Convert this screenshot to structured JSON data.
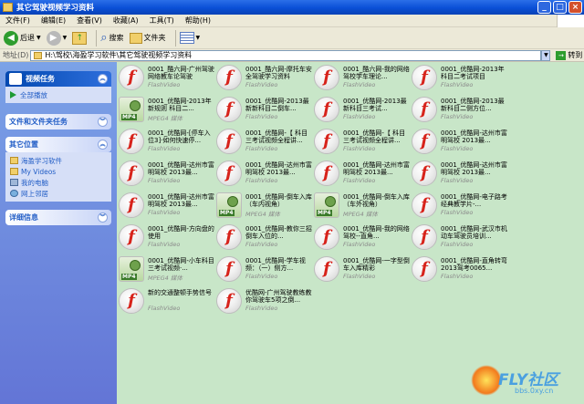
{
  "window": {
    "title": "其它驾驶视频学习资料"
  },
  "menu": [
    "文件(F)",
    "编辑(E)",
    "查看(V)",
    "收藏(A)",
    "工具(T)",
    "帮助(H)"
  ],
  "toolbar": {
    "back": "后退",
    "search": "搜索",
    "folders": "文件夹"
  },
  "address": {
    "label": "地址(D)",
    "path": "H:\\驾校\\海盈学习软件\\其它驾驶视频学习资料",
    "go": "转到"
  },
  "left": {
    "video_tasks": {
      "title": "视频任务",
      "play_all": "全部播放"
    },
    "file_tasks": {
      "title": "文件和文件夹任务"
    },
    "other_places": {
      "title": "其它位置",
      "items": [
        "海盈学习软件",
        "My Videos",
        "我的电脑",
        "网上邻居"
      ]
    },
    "details": {
      "title": "详细信息"
    }
  },
  "files": [
    {
      "name": "0001_酷六网-广州驾驶网络教车论驾驶",
      "type": "FlashVideo",
      "icon": "flash"
    },
    {
      "name": "0001_酷六网-摩托车安全驾驶学习资料",
      "type": "FlashVideo",
      "icon": "flash"
    },
    {
      "name": "0001_酷六网-我的网络驾校学车理论...",
      "type": "FlashVideo",
      "icon": "flash"
    },
    {
      "name": "0001_优酷网-2013年科目二考试项目",
      "type": "FlashVideo",
      "icon": "flash"
    },
    {
      "name": "0001_优酷网-2013年新规则 科目二...",
      "type": "MPEG4 媒体",
      "icon": "mp4"
    },
    {
      "name": "0001_优酷网-2013最新新科目二倒车...",
      "type": "FlashVideo",
      "icon": "flash"
    },
    {
      "name": "0001_优酷网-2013最新科目三考试...",
      "type": "FlashVideo",
      "icon": "flash"
    },
    {
      "name": "0001_优酷网-2013最新科目二侧方位...",
      "type": "FlashVideo",
      "icon": "flash"
    },
    {
      "name": "0001_优酷网-[停车入位3]·如何快速停...",
      "type": "FlashVideo",
      "icon": "flash"
    },
    {
      "name": "0001_优酷网-【 科目三考试视频全程讲...",
      "type": "FlashVideo",
      "icon": "flash"
    },
    {
      "name": "0001_优酷网-【 科目三考试视频全程讲...",
      "type": "FlashVideo",
      "icon": "flash"
    },
    {
      "name": "0001_优酷网-达州市富明驾校 2013最...",
      "type": "FlashVideo",
      "icon": "flash"
    },
    {
      "name": "0001_优酷网-达州市富明驾校 2013最...",
      "type": "FlashVideo",
      "icon": "flash"
    },
    {
      "name": "0001_优酷网-达州市富明驾校 2013最...",
      "type": "FlashVideo",
      "icon": "flash"
    },
    {
      "name": "0001_优酷网-达州市富明驾校 2013最...",
      "type": "FlashVideo",
      "icon": "flash"
    },
    {
      "name": "0001_优酷网-达州市富明驾校 2013最...",
      "type": "FlashVideo",
      "icon": "flash"
    },
    {
      "name": "0001_优酷网-达州市富明驾校 2013最...",
      "type": "FlashVideo",
      "icon": "flash"
    },
    {
      "name": "0001_优酷网-倒车入库（车内视角）",
      "type": "MPEG4 媒体",
      "icon": "mp4"
    },
    {
      "name": "0001_优酷网-倒车入库（车外视角）",
      "type": "MPEG4 媒体",
      "icon": "mp4"
    },
    {
      "name": "0001_优酷网-电子路考经典教学片-...",
      "type": "FlashVideo",
      "icon": "flash"
    },
    {
      "name": "0001_优酷网-方向盘的使用",
      "type": "FlashVideo",
      "icon": "flash"
    },
    {
      "name": "0001_优酷网-教你三招倒车入位的...",
      "type": "FlashVideo",
      "icon": "flash"
    },
    {
      "name": "0001_优酷网-我的网络驾校--直角...",
      "type": "FlashVideo",
      "icon": "flash"
    },
    {
      "name": "0001_优酷网-武汉市机动车驾驶员培训...",
      "type": "FlashVideo",
      "icon": "flash"
    },
    {
      "name": "0001_优酷网-小车科目三考试视频·...",
      "type": "MPEG4 媒体",
      "icon": "mp4"
    },
    {
      "name": "0001_优酷网-学车视频：（一）侧方...",
      "type": "FlashVideo",
      "icon": "flash"
    },
    {
      "name": "0001_优酷网-一字型倒车入库精彩",
      "type": "FlashVideo",
      "icon": "flash"
    },
    {
      "name": "0001_优酷网-直角转弯 2013驾考0065...",
      "type": "FlashVideo",
      "icon": "flash"
    },
    {
      "name": "新的交通整顿手势信号",
      "type": "FlashVideo",
      "icon": "flash"
    },
    {
      "name": "优酷网-广州驾驶教练教你驾驶车5项之倒...",
      "type": "FlashVideo",
      "icon": "flash"
    }
  ],
  "watermark": {
    "brand": "FLY社区",
    "url": "bbs.0xy.cn"
  }
}
